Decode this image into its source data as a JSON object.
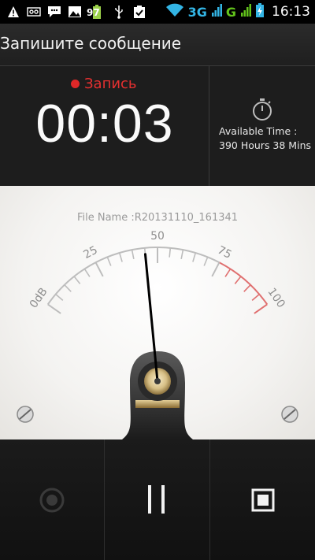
{
  "status_bar": {
    "left_icons": [
      "warning-icon",
      "voicemail-icon",
      "chat-icon",
      "image-icon",
      "battery-saver-icon",
      "usb-icon",
      "check-icon"
    ],
    "battery_percent": "97",
    "network_1": "3G",
    "network_2": "G",
    "time": "16:13"
  },
  "title_bar": {
    "title": "Запишите сообщение"
  },
  "recording": {
    "status_label": "Запись",
    "elapsed": "00:03",
    "available_label": "Available Time :",
    "available_value": "390 Hours 38 Mins"
  },
  "meter": {
    "file_name": "File Name :R20131110_161341",
    "scale_labels": [
      "0dB",
      "25",
      "50",
      "75",
      "100"
    ],
    "level": 0.45,
    "colors": {
      "scale": "#bdbdbd",
      "peak": "#e07070",
      "needle": "#000000"
    }
  },
  "controls": {
    "record_icon": "record-icon",
    "pause_icon": "pause-icon",
    "stop_icon": "stop-icon"
  }
}
